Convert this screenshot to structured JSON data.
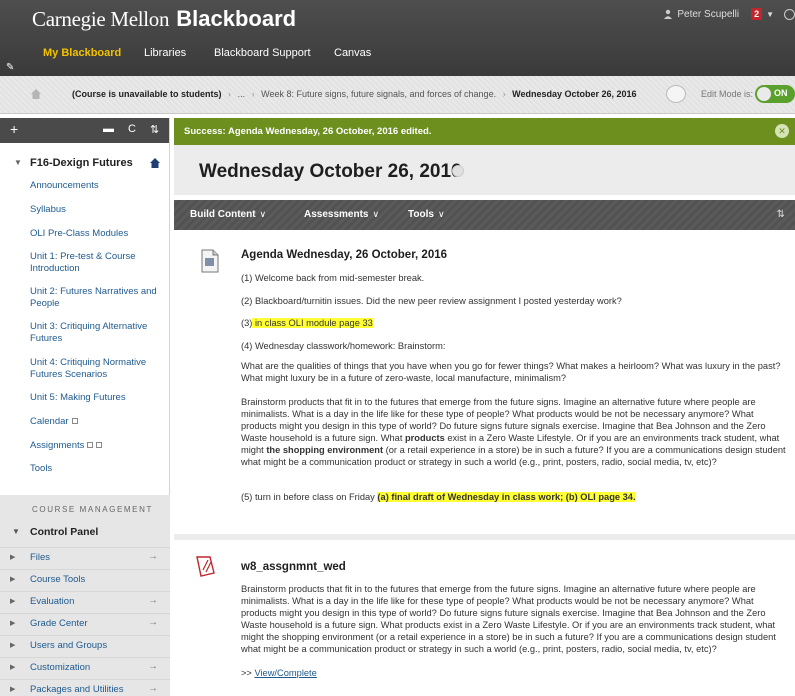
{
  "header": {
    "brand_cmu": "Carnegie Mellon",
    "brand_bb": "Blackboard",
    "user_name": "Peter Scupelli",
    "notification_count": "2",
    "tabs": [
      {
        "label": "My Blackboard",
        "active": true
      },
      {
        "label": "Libraries",
        "active": false
      },
      {
        "label": "Blackboard Support",
        "active": false
      },
      {
        "label": "Canvas",
        "active": false
      }
    ]
  },
  "breadcrumb": {
    "course": "(Course is unavailable to students)",
    "ellipsis": "...",
    "week": "Week 8: Future signs, future signals, and forces of change.",
    "current": "Wednesday October 26, 2016",
    "edit_mode_label": "Edit Mode is:",
    "edit_mode_state": "ON"
  },
  "sidebar": {
    "toolbar": {
      "add": "+",
      "sort": "⇅",
      "refresh": "C"
    },
    "course_title": "F16-Dexign Futures",
    "items": [
      {
        "label": "Announcements"
      },
      {
        "label": "Syllabus"
      },
      {
        "label": "OLI Pre-Class Modules"
      },
      {
        "label": "Unit 1: Pre-test & Course Introduction"
      },
      {
        "label": "Unit 2: Futures Narratives and People"
      },
      {
        "label": "Unit 3: Critiquing Alternative Futures"
      },
      {
        "label": "Unit 4: Critiquing Normative Futures Scenarios"
      },
      {
        "label": "Unit 5: Making Futures"
      },
      {
        "label": "Calendar"
      },
      {
        "label": "Assignments"
      },
      {
        "label": "Tools"
      }
    ],
    "course_management": {
      "heading": "COURSE MANAGEMENT",
      "control_panel": "Control Panel",
      "items": [
        {
          "label": "Files"
        },
        {
          "label": "Course Tools"
        },
        {
          "label": "Evaluation"
        },
        {
          "label": "Grade Center"
        },
        {
          "label": "Users and Groups"
        },
        {
          "label": "Customization"
        },
        {
          "label": "Packages and Utilities"
        }
      ]
    }
  },
  "main": {
    "success_message": "Success: Agenda Wednesday, 26 October, 2016 edited.",
    "page_title": "Wednesday October 26, 2016",
    "action_bar": {
      "build_content": "Build Content",
      "assessments": "Assessments",
      "tools": "Tools"
    },
    "agenda": {
      "title": "Agenda Wednesday, 26 October, 2016",
      "p1": "(1) Welcome back from mid-semester break.",
      "p2": "(2) Blackboard/turnitin issues. Did the new peer review assignment I posted yesterday work?",
      "p3_prefix": "(3)",
      "p3_highlight": " in class OLI module page 33",
      "p4": "(4) Wednesday classwork/homework: Brainstorm:",
      "p5": "What are the qualities of things that you have when you go for fewer things? What makes a heirloom? What was luxury in the past? What might luxury be in a future of zero-waste, local manufacture, minimalism?",
      "p6_a": "Brainstorm products that fit in to the futures that emerge from the future signs. Imagine an alternative future where people are minimalists. What is a day in the life like for these type of people? What products would be not be necessary anymore? What products might you design in this type of world? Do future signs future signals exercise. Imagine that Bea Johnson and the Zero Waste household is a future sign. What ",
      "p6_b": "products",
      "p6_c": " exist in a Zero Waste Lifestyle. Or if you are an environments track student, what might ",
      "p6_d": "the shopping environment",
      "p6_e": " (or a retail experience in a store) be in such a future? If you are a communications design student what might be a communication product or strategy in such a world (e.g., print, posters, radio, social media, tv, etc)?",
      "p7_prefix": "(5) turn in before class on Friday ",
      "p7_highlight": "(a) final draft of Wednesday in class work; (b) OLI page 34."
    },
    "assignment": {
      "title": "w8_assgnmnt_wed",
      "body": "Brainstorm products that fit in to the futures that emerge from the future signs. Imagine an alternative future where people are minimalists. What is a day in the life like for these type of people? What products would be not be necessary anymore? What products might you design in this type of world? Do future signs future signals exercise. Imagine that Bea Johnson and the Zero Waste household is a future sign. What products exist in a Zero Waste Lifestyle. Or if you are an environments track student, what might the shopping environment (or a retail experience in a store) be in such a future? If you are a communications design student what might be a communication product or strategy in such a world (e.g., print, posters, radio, social media, tv, etc)?",
      "link_prefix": ">> ",
      "link_label": "View/Complete"
    }
  },
  "colors": {
    "success_green": "#6c8f1e",
    "highlight_yellow": "#ffff33",
    "link_blue": "#1f5a8f",
    "active_tab": "#f2c200"
  }
}
